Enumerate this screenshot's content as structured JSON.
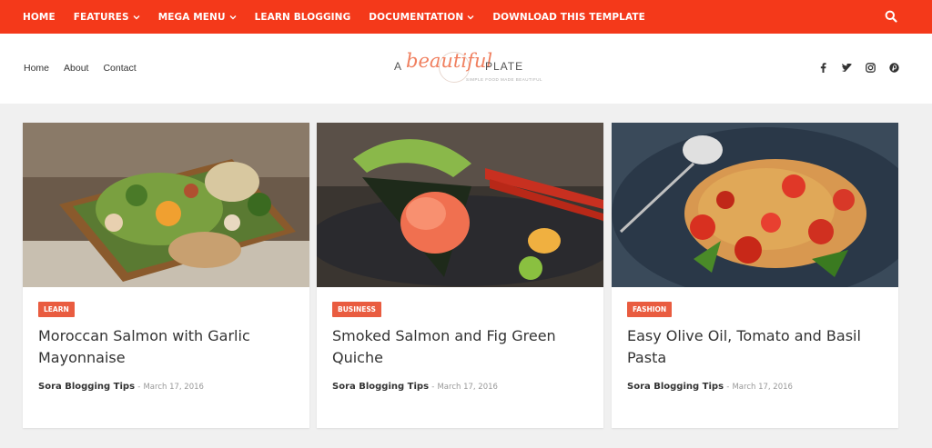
{
  "topnav": {
    "items": [
      {
        "label": "HOME",
        "dropdown": false
      },
      {
        "label": "FEATURES",
        "dropdown": true
      },
      {
        "label": "MEGA MENU",
        "dropdown": true
      },
      {
        "label": "LEARN BLOGGING",
        "dropdown": false
      },
      {
        "label": "DOCUMENTATION",
        "dropdown": true
      },
      {
        "label": "DOWNLOAD THIS TEMPLATE",
        "dropdown": false
      }
    ],
    "search_icon": "search-icon",
    "color": "#f4391a"
  },
  "header": {
    "links": [
      "Home",
      "About",
      "Contact"
    ],
    "logo": {
      "a": "A",
      "beautiful": "beautiful",
      "plate": "PLATE",
      "tagline": "SIMPLE FOOD MADE BEAUTIFUL"
    },
    "social": [
      "facebook-icon",
      "twitter-icon",
      "instagram-icon",
      "pinterest-icon"
    ]
  },
  "posts": [
    {
      "badge": "LEARN",
      "title": "Moroccan Salmon with Garlic Mayonnaise",
      "author": "Sora Blogging Tips",
      "separator": "-",
      "date": "March 17, 2016"
    },
    {
      "badge": "BUSINESS",
      "title": "Smoked Salmon and Fig Green Quiche",
      "author": "Sora Blogging Tips",
      "separator": "-",
      "date": "March 17, 2016"
    },
    {
      "badge": "FASHION",
      "title": "Easy Olive Oil, Tomato and Basil Pasta",
      "author": "Sora Blogging Tips",
      "separator": "-",
      "date": "March 17, 2016"
    }
  ],
  "accent": "#e95c40"
}
